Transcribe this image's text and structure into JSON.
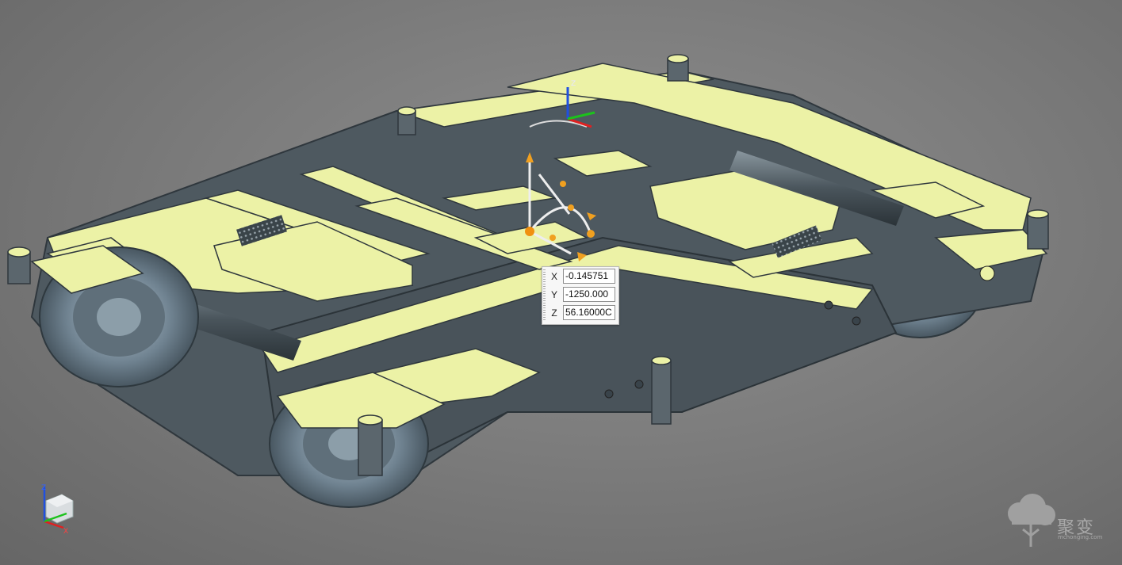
{
  "coordinates": {
    "x_label": "X",
    "x_value": "-0.145751",
    "y_label": "Y",
    "y_value": "-1250.000",
    "z_label": "Z",
    "z_value": "56.16000C"
  },
  "triad": {
    "x": "X",
    "y": "Y",
    "z": "Z"
  },
  "watermark": {
    "text": "聚变",
    "url": "mchonging.com"
  },
  "colors": {
    "section_face": "#ecf2a6",
    "body": "#4e5960",
    "body_dark": "#2f373d",
    "wheel": "#8fa3b2",
    "axis_x": "#e02020",
    "axis_y": "#1cc21c",
    "axis_z": "#2050e0",
    "handle": "#f0a020"
  }
}
